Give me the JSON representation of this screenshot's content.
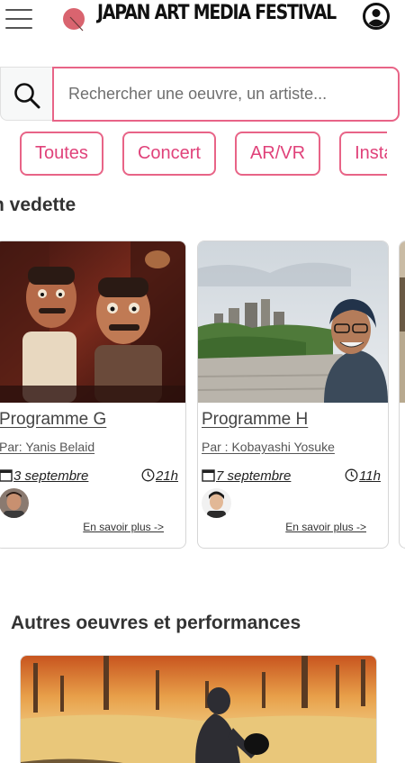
{
  "header": {
    "title": "JAPAN ART MEDIA FESTIVAL",
    "menu_icon": "hamburger-menu-icon",
    "logo_icon": "festival-logo-icon",
    "profile_icon": "user-profile-icon"
  },
  "search": {
    "placeholder": "Rechercher une oeuvre, un artiste...",
    "icon": "search-icon"
  },
  "filters": [
    "Toutes",
    "Concert",
    "AR/VR",
    "Insta"
  ],
  "featured": {
    "title": "n vedette",
    "cards": [
      {
        "name": "Programme G",
        "author": "Par: Yanis Belaid",
        "date": "3 septembre",
        "time": "21h",
        "more": "En savoir plus ->"
      },
      {
        "name": "Programme H",
        "author": "Par : Kobayashi Yosuke",
        "date": "7 septembre",
        "time": "11h",
        "more": "En savoir plus ->"
      }
    ]
  },
  "other": {
    "title": "Autres oeuvres et performances"
  },
  "colors": {
    "accent": "#e86487",
    "accent_text": "#e0427a",
    "logo": "#d9646f"
  }
}
